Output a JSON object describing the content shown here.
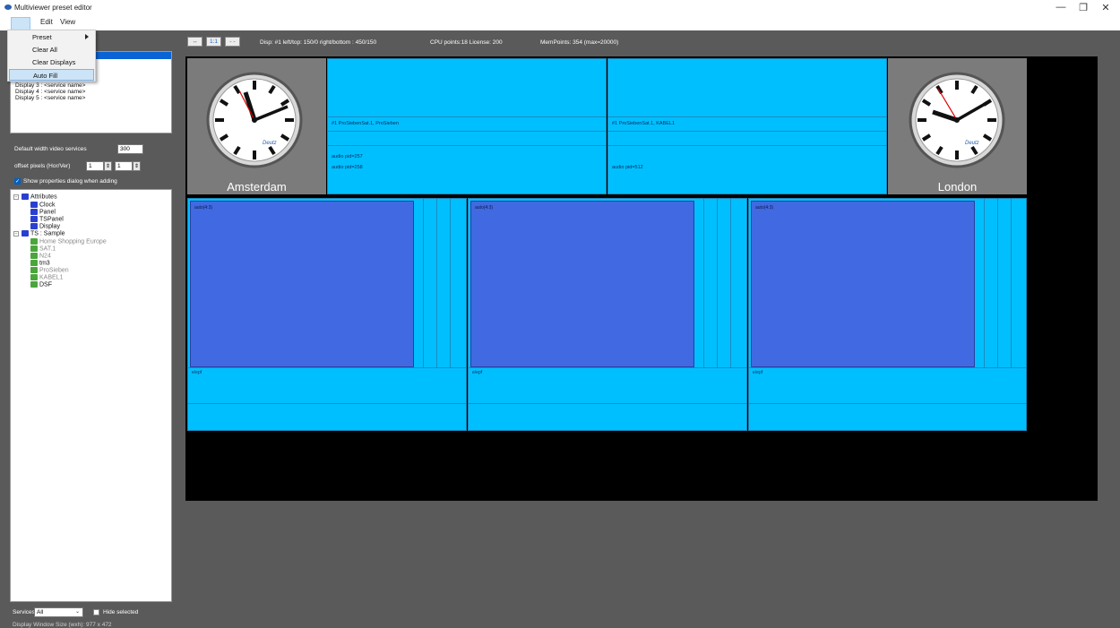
{
  "window": {
    "title": "Multiviewer preset editor",
    "minimize": "—",
    "restore": "❐",
    "close": "✕"
  },
  "menubar": {
    "items": [
      "Edit",
      "View"
    ]
  },
  "dropdown": {
    "items": [
      {
        "label": "Preset",
        "has_submenu": true
      },
      {
        "label": "Clear All"
      },
      {
        "label": "Clear Displays"
      },
      {
        "label": "Auto Fill",
        "highlighted": true
      }
    ]
  },
  "displays": {
    "items": [
      "Display 3 : <service name>",
      "Display 4 : <service name>",
      "Display 5 : <service name>"
    ]
  },
  "settings": {
    "default_width_label": "Default width video services",
    "default_width_value": "300",
    "offset_label": "offset pixels (Hor/Ver)",
    "offset_hor": "1",
    "offset_ver": "1",
    "show_props_label": "Show properties dialog when adding",
    "show_props_checked": true
  },
  "tree": {
    "attributes_label": "Attributes",
    "attributes_children": [
      "Clock",
      "Panel",
      "TSPanel",
      "Display"
    ],
    "ts_label": "TS : Sample",
    "services": [
      {
        "label": "Home Shopping Europe",
        "greyed": true
      },
      {
        "label": "SAT.1",
        "greyed": true
      },
      {
        "label": "N24",
        "greyed": true
      },
      {
        "label": "tm3",
        "greyed": false
      },
      {
        "label": "ProSieben",
        "greyed": true
      },
      {
        "label": "KABEL1",
        "greyed": true
      },
      {
        "label": "DSF",
        "greyed": false
      }
    ]
  },
  "toolbar": {
    "btn_fit": "↔",
    "btn_1to1": "1:1",
    "btn_dash": "- -",
    "disp_info": "Disp: #1  left/top: 150/0  right/bottom : 450/150",
    "cpu_info": "CPU points:18 License: 200",
    "mem_info": "MemPoints: 354 (max=20000)"
  },
  "canvas": {
    "clock_left_city": "Amsterdam",
    "clock_right_city": "London",
    "clock_brand": "Deutz",
    "ts_panel_1": {
      "line1": "#1  ProSiebenSat.1, ProSieben",
      "audio1": "audio pid=257",
      "audio2": "audio pid=258"
    },
    "ts_panel_2": {
      "line1": "#1  ProSiebenSat.1, KABEL1",
      "audio1": "audio pid=512"
    },
    "video_label": "auto(4:3)",
    "epg_label": "e/epf"
  },
  "bottom": {
    "services_label": "Services",
    "services_value": "All",
    "hide_selected_label": "Hide selected",
    "status": "Display Window Size (wxh): 977 x 472"
  },
  "colors": {
    "ts_panel": "#00bfff",
    "video": "#4169e1",
    "clock_bg": "#7b7b7b",
    "canvas_bg": "#000000",
    "selection": "#0a64d6"
  }
}
